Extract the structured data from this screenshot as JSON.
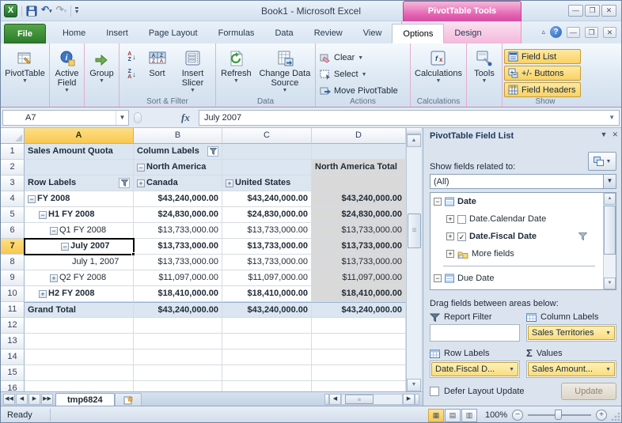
{
  "window": {
    "title": "Book1 - Microsoft Excel",
    "contextual_group": "PivotTable Tools"
  },
  "qat_icons": [
    "excel-logo",
    "save",
    "undo",
    "redo",
    "customize-qat"
  ],
  "window_buttons": [
    "minimize",
    "restore",
    "close"
  ],
  "tabs": {
    "items": [
      "File",
      "Home",
      "Insert",
      "Page Layout",
      "Formulas",
      "Data",
      "Review",
      "View",
      "Options",
      "Design"
    ],
    "active": "Options",
    "contextual": [
      "Options",
      "Design"
    ],
    "file_tab": "File"
  },
  "ribbon": {
    "pivottable_label": "PivotTable",
    "active_field_label": "Active Field",
    "group_label": "Group",
    "sort_label": "Sort",
    "insert_slicer_label": "Insert Slicer",
    "sort_filter_group": "Sort & Filter",
    "refresh_label": "Refresh",
    "change_data_label": "Change Data Source",
    "data_group": "Data",
    "clear_label": "Clear",
    "select_label": "Select",
    "move_label": "Move PivotTable",
    "actions_group": "Actions",
    "calculations_label": "Calculations",
    "tools_label": "Tools",
    "field_list_label": "Field List",
    "plus_minus_label": "+/- Buttons",
    "field_headers_label": "Field Headers",
    "show_group": "Show"
  },
  "formula_bar": {
    "name_box": "A7",
    "fx": "fx",
    "content": "July 2007"
  },
  "grid": {
    "column_headers": [
      "A",
      "B",
      "C",
      "D"
    ],
    "selected_cell": "A7",
    "selected_column": "A",
    "selected_row": 7,
    "rows": [
      {
        "n": "1",
        "cells": [
          {
            "t": "Sales Amount Quota",
            "b": 1,
            "bg": "h"
          },
          {
            "t": "Column Labels",
            "b": 1,
            "bg": "h",
            "filter": 1
          },
          {
            "t": "",
            "bg": "h"
          },
          {
            "t": "",
            "bg": "h"
          }
        ]
      },
      {
        "n": "2",
        "cells": [
          {
            "t": "",
            "bg": "h"
          },
          {
            "t": "North America",
            "b": 1,
            "bg": "h",
            "ic": "m"
          },
          {
            "t": "",
            "bg": "h"
          },
          {
            "t": "North America Total",
            "b": 1,
            "bg": "g"
          }
        ]
      },
      {
        "n": "3",
        "cells": [
          {
            "t": "Row Labels",
            "b": 1,
            "bg": "h",
            "filter": 1
          },
          {
            "t": "Canada",
            "b": 1,
            "bg": "h",
            "ic": "p"
          },
          {
            "t": "United States",
            "b": 1,
            "bg": "h",
            "ic": "p"
          },
          {
            "t": "",
            "bg": "g"
          }
        ]
      },
      {
        "n": "4",
        "cells": [
          {
            "t": "FY 2008",
            "b": 1,
            "ic": "m",
            "ind": 0
          },
          {
            "t": "$43,240,000.00",
            "b": 1,
            "al": "r"
          },
          {
            "t": "$43,240,000.00",
            "b": 1,
            "al": "r"
          },
          {
            "t": "$43,240,000.00",
            "b": 1,
            "al": "r",
            "bg": "g"
          }
        ]
      },
      {
        "n": "5",
        "cells": [
          {
            "t": "H1 FY 2008",
            "b": 1,
            "ic": "m",
            "ind": 1
          },
          {
            "t": "$24,830,000.00",
            "b": 1,
            "al": "r"
          },
          {
            "t": "$24,830,000.00",
            "b": 1,
            "al": "r"
          },
          {
            "t": "$24,830,000.00",
            "b": 1,
            "al": "r",
            "bg": "g"
          }
        ]
      },
      {
        "n": "6",
        "cells": [
          {
            "t": "Q1 FY 2008",
            "ic": "m",
            "ind": 2
          },
          {
            "t": "$13,733,000.00",
            "al": "r"
          },
          {
            "t": "$13,733,000.00",
            "al": "r"
          },
          {
            "t": "$13,733,000.00",
            "al": "r",
            "bg": "g"
          }
        ]
      },
      {
        "n": "7",
        "sel": 1,
        "cells": [
          {
            "t": "July 2007",
            "b": 1,
            "ic": "m",
            "ind": 3
          },
          {
            "t": "$13,733,000.00",
            "b": 1,
            "al": "r"
          },
          {
            "t": "$13,733,000.00",
            "b": 1,
            "al": "r"
          },
          {
            "t": "$13,733,000.00",
            "b": 1,
            "al": "r",
            "bg": "g"
          }
        ]
      },
      {
        "n": "8",
        "cells": [
          {
            "t": "July 1, 2007",
            "ind": 4
          },
          {
            "t": "$13,733,000.00",
            "al": "r"
          },
          {
            "t": "$13,733,000.00",
            "al": "r"
          },
          {
            "t": "$13,733,000.00",
            "al": "r",
            "bg": "g"
          }
        ]
      },
      {
        "n": "9",
        "cells": [
          {
            "t": "Q2 FY 2008",
            "ic": "p",
            "ind": 2
          },
          {
            "t": "$11,097,000.00",
            "al": "r"
          },
          {
            "t": "$11,097,000.00",
            "al": "r"
          },
          {
            "t": "$11,097,000.00",
            "al": "r",
            "bg": "g"
          }
        ]
      },
      {
        "n": "10",
        "cells": [
          {
            "t": "H2 FY 2008",
            "b": 1,
            "ic": "p",
            "ind": 1
          },
          {
            "t": "$18,410,000.00",
            "b": 1,
            "al": "r"
          },
          {
            "t": "$18,410,000.00",
            "b": 1,
            "al": "r"
          },
          {
            "t": "$18,410,000.00",
            "b": 1,
            "al": "r",
            "bg": "g"
          }
        ]
      },
      {
        "n": "11",
        "cells": [
          {
            "t": "Grand Total",
            "b": 1,
            "bg": "t"
          },
          {
            "t": "$43,240,000.00",
            "b": 1,
            "al": "r",
            "bg": "t"
          },
          {
            "t": "$43,240,000.00",
            "b": 1,
            "al": "r",
            "bg": "t"
          },
          {
            "t": "$43,240,000.00",
            "b": 1,
            "al": "r",
            "bg": "t"
          }
        ]
      },
      {
        "n": "12",
        "cells": [
          {
            "t": ""
          },
          {
            "t": ""
          },
          {
            "t": ""
          },
          {
            "t": ""
          }
        ]
      },
      {
        "n": "13",
        "cells": [
          {
            "t": ""
          },
          {
            "t": ""
          },
          {
            "t": ""
          },
          {
            "t": ""
          }
        ]
      },
      {
        "n": "14",
        "cells": [
          {
            "t": ""
          },
          {
            "t": ""
          },
          {
            "t": ""
          },
          {
            "t": ""
          }
        ]
      },
      {
        "n": "15",
        "cells": [
          {
            "t": ""
          },
          {
            "t": ""
          },
          {
            "t": ""
          },
          {
            "t": ""
          }
        ]
      },
      {
        "n": "16",
        "cells": [
          {
            "t": ""
          },
          {
            "t": ""
          },
          {
            "t": ""
          },
          {
            "t": ""
          }
        ]
      }
    ]
  },
  "field_list": {
    "title": "PivotTable Field List",
    "show_fields_label": "Show fields related to:",
    "source_dropdown_value": "(All)",
    "tree": [
      {
        "label": "Date",
        "bold": 1,
        "exp": "m",
        "icon": "table"
      },
      {
        "label": "Date.Calendar Date",
        "exp": "p",
        "check": 0,
        "indent": 1
      },
      {
        "label": "Date.Fiscal Date",
        "bold": 1,
        "exp": "p",
        "check": 1,
        "filter": 1,
        "indent": 1
      },
      {
        "label": "More fields",
        "exp": "p",
        "icon": "folder",
        "indent": 1
      },
      {
        "sep": 1
      },
      {
        "label": "Due Date",
        "exp": "m",
        "icon": "table"
      }
    ],
    "drag_label": "Drag fields between areas below:",
    "areas": [
      {
        "icon": "funnel",
        "label": "Report Filter",
        "items": []
      },
      {
        "icon": "grid",
        "label": "Column Labels",
        "items": [
          "Sales Territories"
        ]
      },
      {
        "icon": "grid",
        "label": "Row Labels",
        "items": [
          "Date.Fiscal D..."
        ]
      },
      {
        "icon": "sigma",
        "label": "Values",
        "items": [
          "Sales Amount..."
        ]
      }
    ],
    "defer_label": "Defer Layout Update",
    "update_button": "Update"
  },
  "sheet_tabs": {
    "active": "tmp6824"
  },
  "status_bar": {
    "ready": "Ready",
    "zoom_level": "100%",
    "views": [
      "normal",
      "page-layout",
      "page-break-preview"
    ]
  },
  "colors": {
    "contextual_pink": "#d9539f",
    "highlight_amber": "#f9c84e",
    "pivot_header_blue": "#dce6f1",
    "total_column_gray": "#d9d9d9",
    "toggle_active_yellow": "#f9d262",
    "file_tab_green": "#2d7c2b"
  }
}
